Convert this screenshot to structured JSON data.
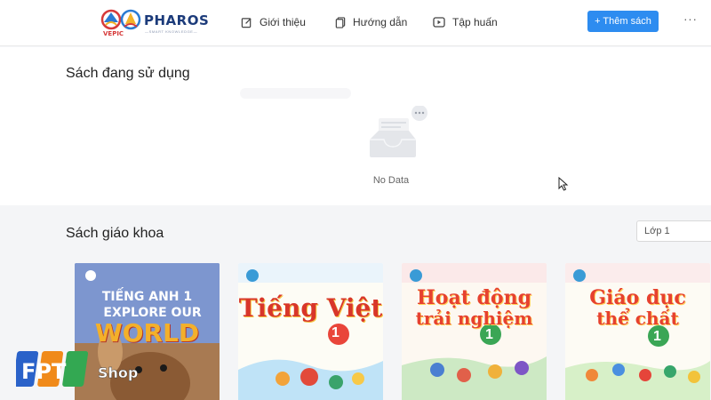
{
  "header": {
    "logo_text": "PHAROS",
    "logo_sub": "—SMART KNOWLEDGE—",
    "logo_brand": "VEPIC",
    "nav": [
      {
        "label": "Giới thiệu",
        "icon": "edit-icon"
      },
      {
        "label": "Hướng dẫn",
        "icon": "document-icon"
      },
      {
        "label": "Tập huấn",
        "icon": "video-play-icon"
      }
    ],
    "add_button": "+ Thêm sách",
    "more_label": "···"
  },
  "in_use": {
    "title": "Sách đang sử dụng",
    "empty_text": "No Data"
  },
  "textbooks": {
    "title": "Sách giáo khoa",
    "grade_selected": "Lớp 1",
    "books": [
      {
        "title_line1": "TIẾNG ANH 1",
        "title_line2": "EXPLORE OUR",
        "title_line3": "WORLD",
        "bg": "#6a86c4"
      },
      {
        "title_line1": "Tiếng Việt",
        "number": "1",
        "bg": "#ffffff"
      },
      {
        "title_line1": "Hoạt động",
        "title_line2": "trải nghiệm",
        "number": "1",
        "bg": "#ffffff"
      },
      {
        "title_line1": "Giáo dục",
        "title_line2": "thể chất",
        "number": "1",
        "bg": "#ffffff"
      }
    ]
  },
  "watermark": {
    "brand": "FPT",
    "shop": "Shop"
  },
  "colors": {
    "accent": "#2d8cf0",
    "page_bg": "#f4f5f7",
    "card_bg": "#ffffff"
  }
}
